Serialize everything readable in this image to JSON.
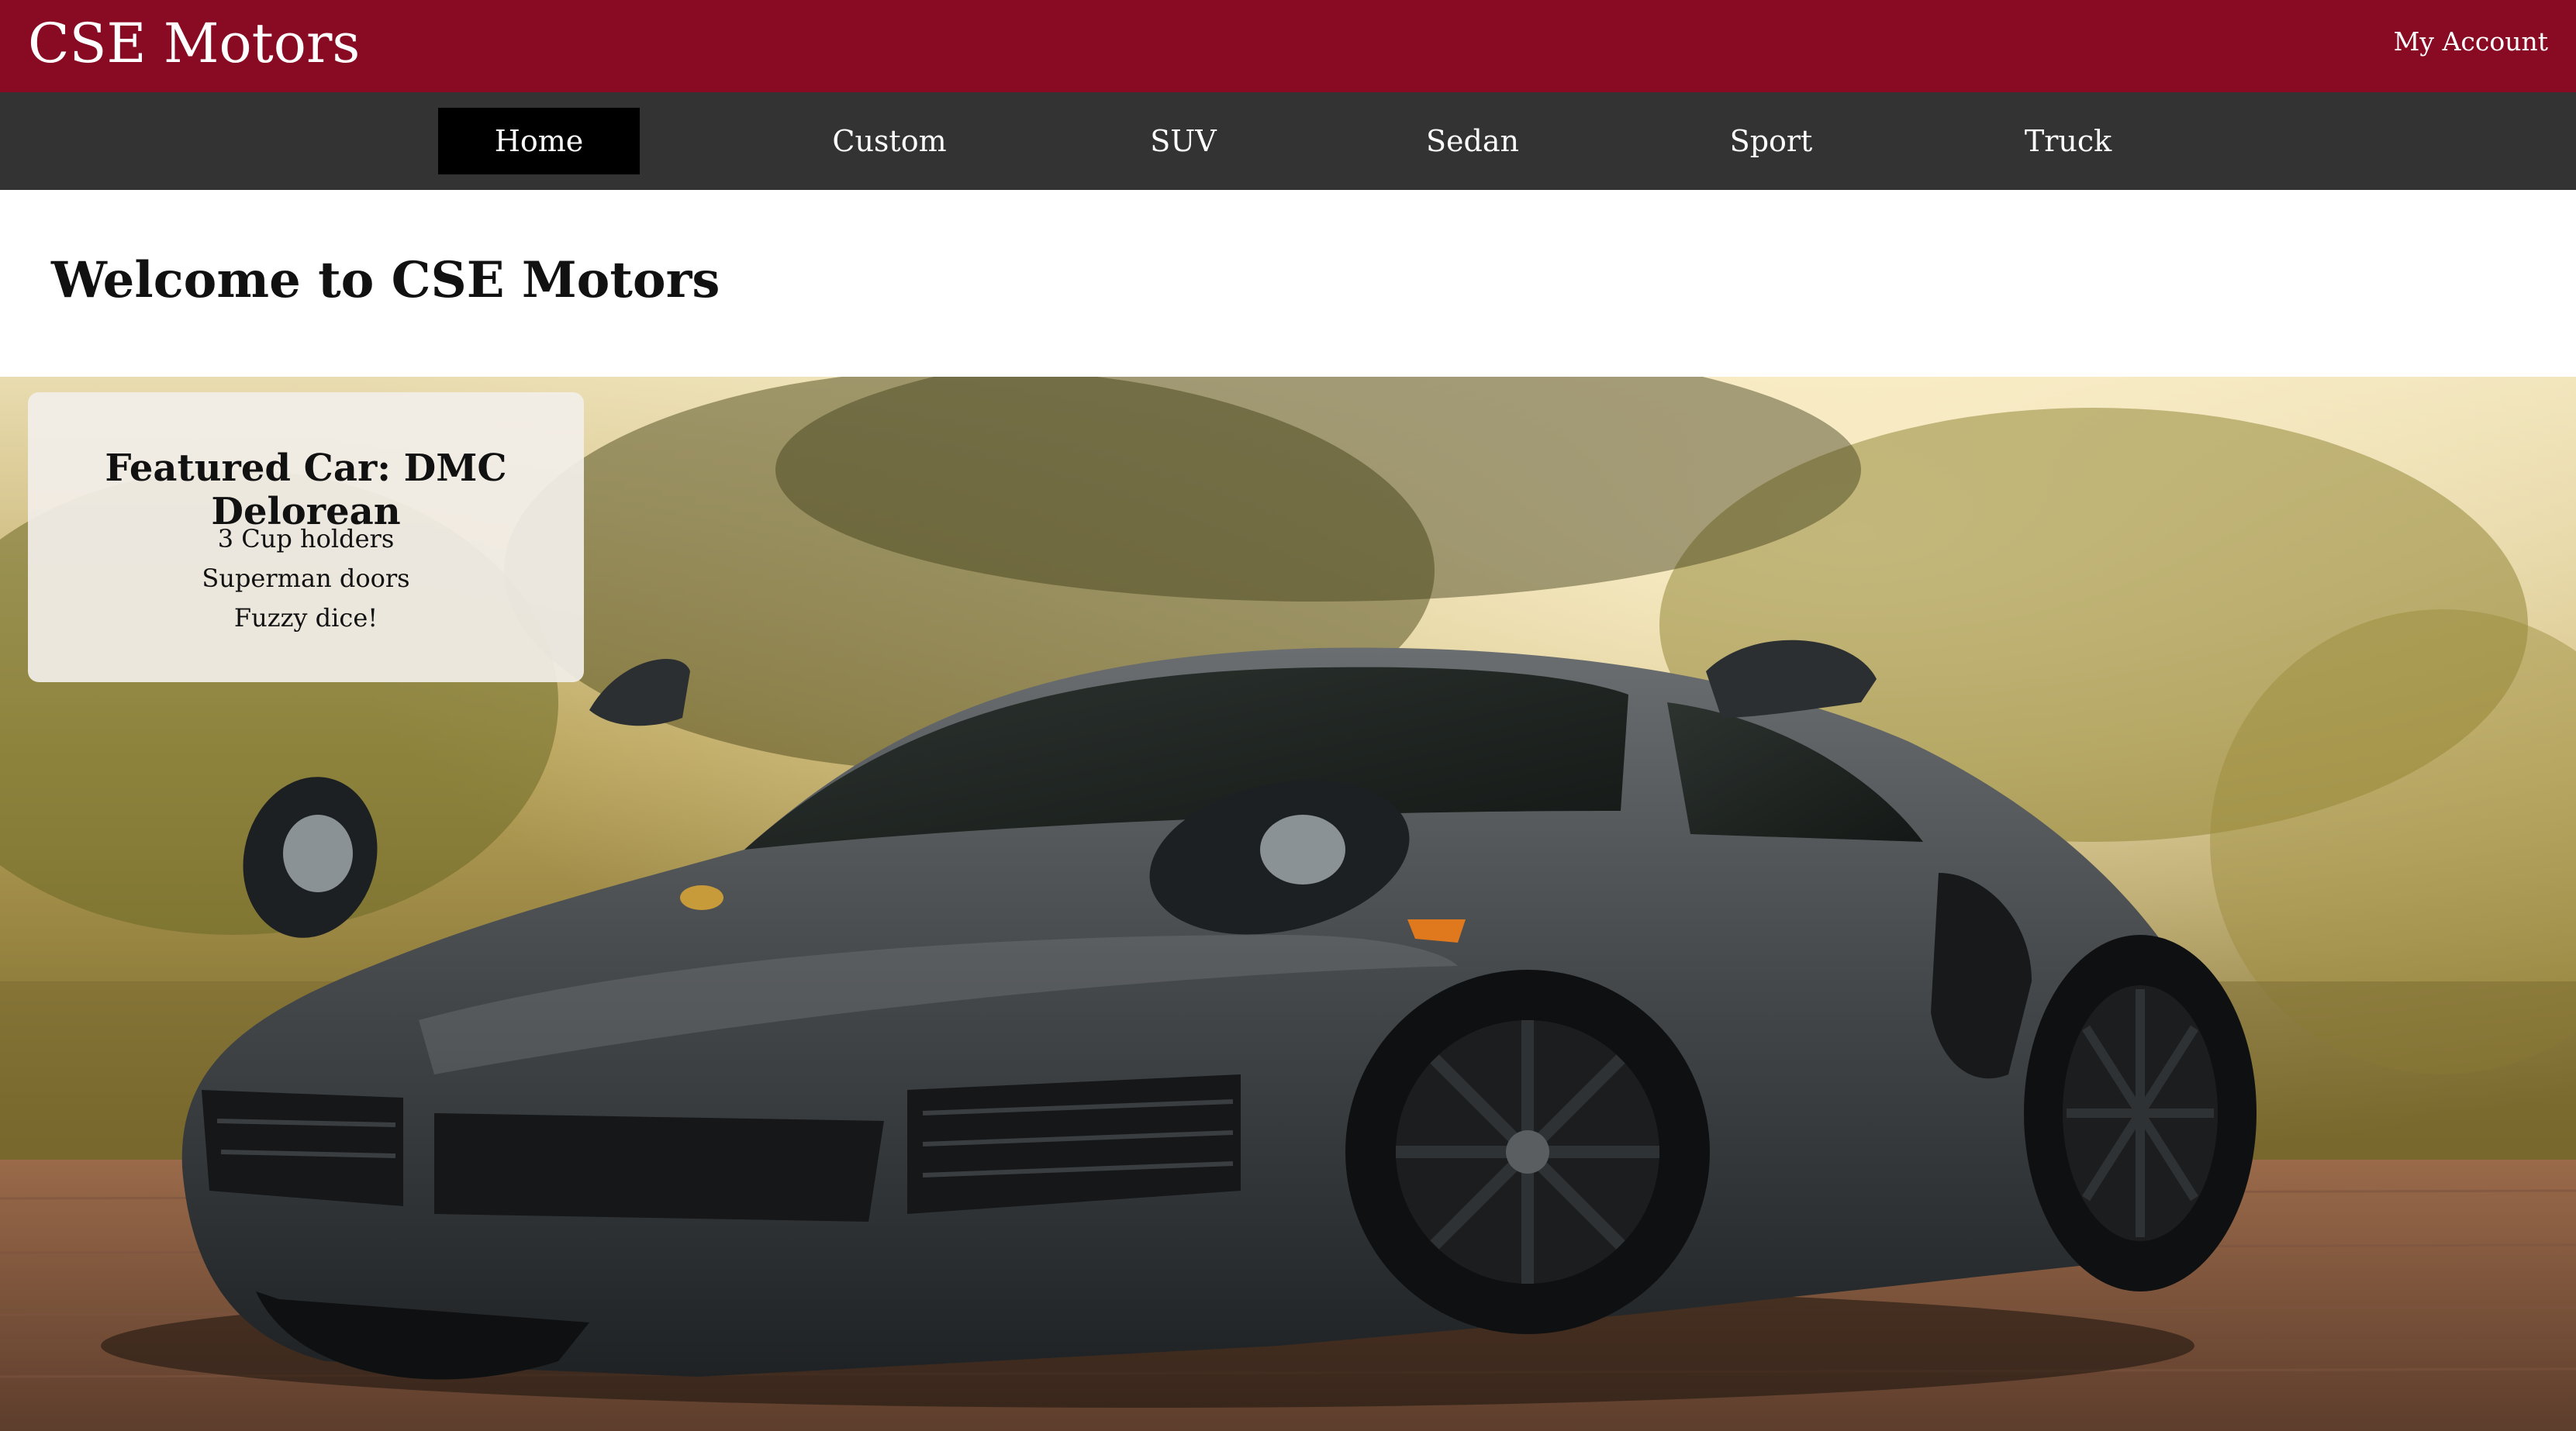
{
  "header": {
    "brand": "CSE Motors",
    "account_link": "My Account"
  },
  "nav": {
    "items": [
      {
        "label": "Home",
        "active": true
      },
      {
        "label": "Custom",
        "active": false
      },
      {
        "label": "SUV",
        "active": false
      },
      {
        "label": "Sedan",
        "active": false
      },
      {
        "label": "Sport",
        "active": false
      },
      {
        "label": "Truck",
        "active": false
      }
    ]
  },
  "main": {
    "heading": "Welcome to CSE Motors"
  },
  "feature": {
    "title": "Featured Car: DMC Delorean",
    "items": [
      "3 Cup holders",
      "Superman doors",
      "Fuzzy dice!"
    ]
  },
  "theme": {
    "brand_color": "#880a23",
    "nav_background": "#333333",
    "nav_active_background": "#000000"
  }
}
